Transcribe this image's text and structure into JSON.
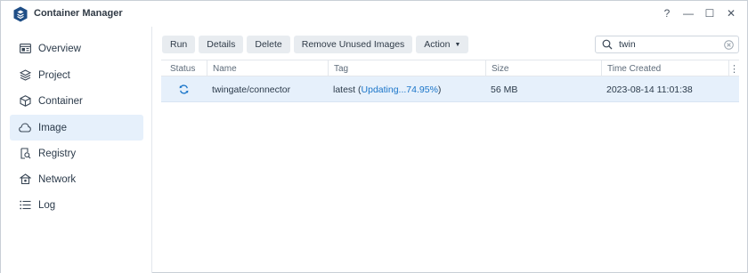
{
  "app": {
    "title": "Container Manager"
  },
  "window_controls": {
    "help": "?",
    "minimize": "—",
    "maximize": "☐",
    "close": "✕"
  },
  "sidebar": {
    "items": [
      {
        "label": "Overview",
        "icon": "overview-icon",
        "active": false
      },
      {
        "label": "Project",
        "icon": "project-icon",
        "active": false
      },
      {
        "label": "Container",
        "icon": "container-icon",
        "active": false
      },
      {
        "label": "Image",
        "icon": "image-cloud-icon",
        "active": true
      },
      {
        "label": "Registry",
        "icon": "registry-icon",
        "active": false
      },
      {
        "label": "Network",
        "icon": "network-icon",
        "active": false
      },
      {
        "label": "Log",
        "icon": "log-icon",
        "active": false
      }
    ]
  },
  "toolbar": {
    "run": "Run",
    "details": "Details",
    "delete": "Delete",
    "remove_unused": "Remove Unused Images",
    "action": "Action"
  },
  "search": {
    "value": "twin",
    "placeholder": ""
  },
  "table": {
    "columns": [
      "Status",
      "Name",
      "Tag",
      "Size",
      "Time Created"
    ],
    "rows": [
      {
        "status_icon": "sync-icon",
        "name": "twingate/connector",
        "tag_prefix": "latest (",
        "tag_progress": "Updating...74.95%",
        "tag_suffix": ")",
        "size": "56 MB",
        "time_created": "2023-08-14 11:01:38"
      }
    ]
  },
  "colors": {
    "accent": "#1a75c9",
    "selected_row": "#e6f0fb",
    "button_bg": "#e8ecf0"
  }
}
